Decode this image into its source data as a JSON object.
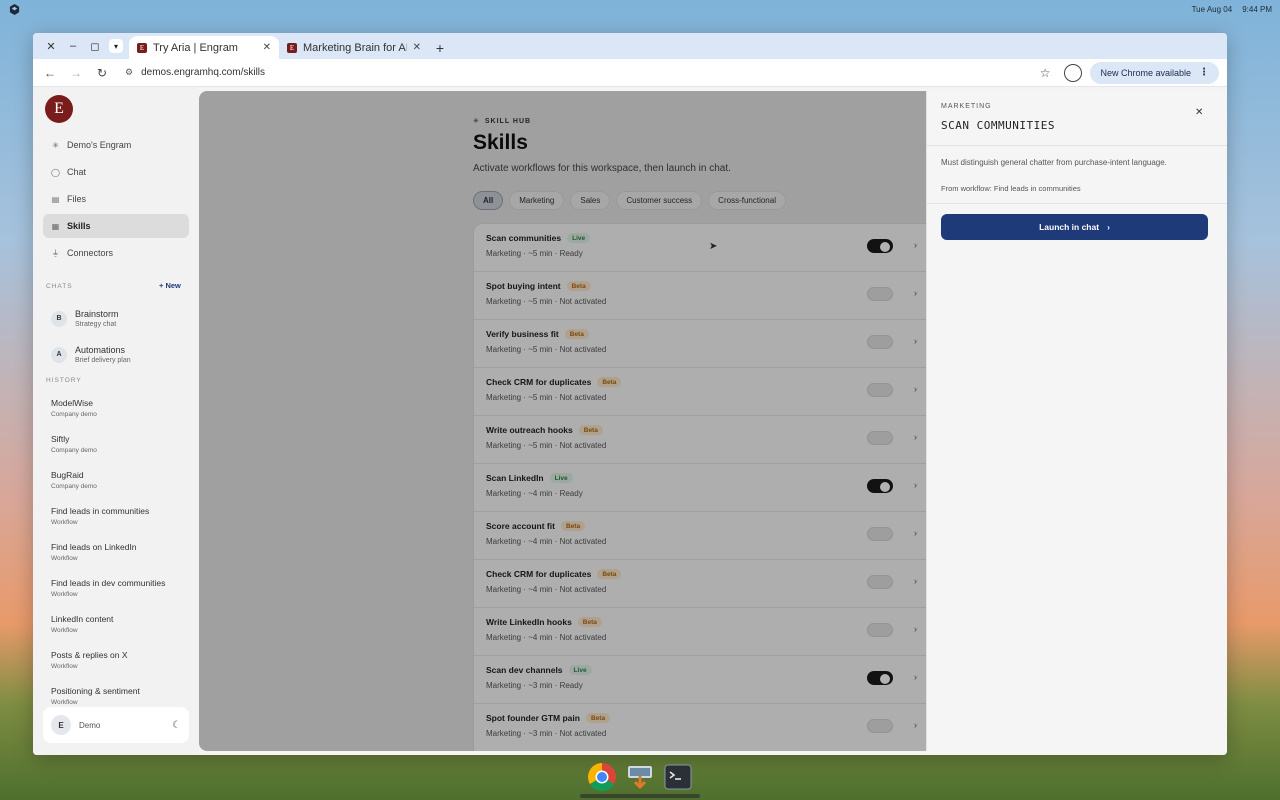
{
  "os": {
    "date": "Tue Aug 04",
    "time": "9:44 PM"
  },
  "browser": {
    "tabs": [
      {
        "favicon": "E",
        "title": "Try Aria | Engram",
        "active": true
      },
      {
        "favicon": "E",
        "title": "Marketing Brain for AI N",
        "active": false
      }
    ],
    "url": "demos.engramhq.com/skills",
    "new_chrome_label": "New Chrome available"
  },
  "sidebar": {
    "logo_letter": "E",
    "nav": [
      {
        "icon": "sparkle-icon",
        "glyph": "✳",
        "label": "Demo's Engram"
      },
      {
        "icon": "chat-icon",
        "glyph": "◯",
        "label": "Chat"
      },
      {
        "icon": "file-icon",
        "glyph": "▤",
        "label": "Files"
      },
      {
        "icon": "skills-icon",
        "glyph": "▦",
        "label": "Skills",
        "active": true
      },
      {
        "icon": "plug-icon",
        "glyph": "⏚",
        "label": "Connectors"
      }
    ],
    "chats_label": "CHATS",
    "new_label": "+ New",
    "chats": [
      {
        "initial": "B",
        "title": "Brainstorm",
        "subtitle": "Strategy chat"
      },
      {
        "initial": "A",
        "title": "Automations",
        "subtitle": "Brief delivery plan"
      }
    ],
    "history_label": "HISTORY",
    "history": [
      {
        "title": "ModelWise",
        "subtitle": "Company demo"
      },
      {
        "title": "Siftly",
        "subtitle": "Company demo"
      },
      {
        "title": "BugRaid",
        "subtitle": "Company demo"
      },
      {
        "title": "Find leads in communities",
        "subtitle": "Workflow"
      },
      {
        "title": "Find leads on LinkedIn",
        "subtitle": "Workflow"
      },
      {
        "title": "Find leads in dev communities",
        "subtitle": "Workflow"
      },
      {
        "title": "LinkedIn content",
        "subtitle": "Workflow"
      },
      {
        "title": "Posts & replies on X",
        "subtitle": "Workflow"
      },
      {
        "title": "Positioning & sentiment",
        "subtitle": "Workflow"
      }
    ],
    "user": {
      "initial": "E",
      "name": "Demo"
    }
  },
  "main": {
    "eyebrow": "SKILL HUB",
    "title": "Skills",
    "subtitle": "Activate workflows for this workspace, then launch in chat.",
    "filters": [
      {
        "label": "All",
        "active": true
      },
      {
        "label": "Marketing"
      },
      {
        "label": "Sales"
      },
      {
        "label": "Customer success"
      },
      {
        "label": "Cross-functional"
      }
    ],
    "skills": [
      {
        "name": "Scan communities",
        "badge": "Live",
        "meta": "Marketing · ~5 min · Ready",
        "on": true
      },
      {
        "name": "Spot buying intent",
        "badge": "Beta",
        "meta": "Marketing · ~5 min · Not activated",
        "on": false
      },
      {
        "name": "Verify business fit",
        "badge": "Beta",
        "meta": "Marketing · ~5 min · Not activated",
        "on": false
      },
      {
        "name": "Check CRM for duplicates",
        "badge": "Beta",
        "meta": "Marketing · ~5 min · Not activated",
        "on": false
      },
      {
        "name": "Write outreach hooks",
        "badge": "Beta",
        "meta": "Marketing · ~5 min · Not activated",
        "on": false
      },
      {
        "name": "Scan LinkedIn",
        "badge": "Live",
        "meta": "Marketing · ~4 min · Ready",
        "on": true
      },
      {
        "name": "Score account fit",
        "badge": "Beta",
        "meta": "Marketing · ~4 min · Not activated",
        "on": false
      },
      {
        "name": "Check CRM for duplicates",
        "badge": "Beta",
        "meta": "Marketing · ~4 min · Not activated",
        "on": false
      },
      {
        "name": "Write LinkedIn hooks",
        "badge": "Beta",
        "meta": "Marketing · ~4 min · Not activated",
        "on": false
      },
      {
        "name": "Scan dev channels",
        "badge": "Live",
        "meta": "Marketing · ~3 min · Ready",
        "on": true
      },
      {
        "name": "Spot founder GTM pain",
        "badge": "Beta",
        "meta": "Marketing · ~3 min · Not activated",
        "on": false
      }
    ]
  },
  "panel": {
    "category": "MARKETING",
    "title": "SCAN COMMUNITIES",
    "description": "Must distinguish general chatter from purchase-intent language.",
    "source": "From workflow: Find leads in communities",
    "launch_label": "Launch in chat"
  },
  "colors": {
    "brand": "#7b1c1c",
    "accent": "#1f3a78",
    "live": "#2f7d47",
    "beta": "#b0681b"
  }
}
